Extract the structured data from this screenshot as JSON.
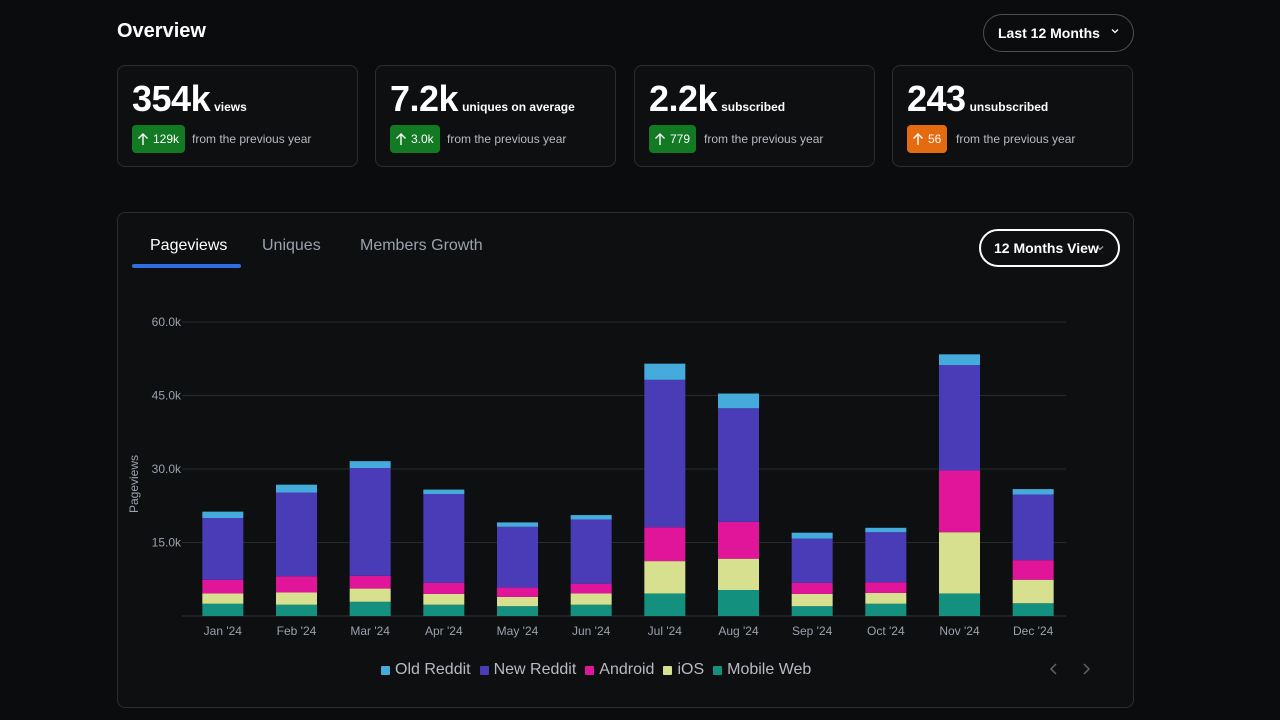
{
  "header": {
    "title": "Overview",
    "range_select": "Last 12 Months"
  },
  "stats": [
    {
      "value": "354k",
      "unit": "views",
      "delta": "129k",
      "delta_text": "from the previous year",
      "delta_color": "#117a22"
    },
    {
      "value": "7.2k",
      "unit": "uniques on average",
      "delta": "3.0k",
      "delta_text": "from the previous year",
      "delta_color": "#117a22"
    },
    {
      "value": "2.2k",
      "unit": "subscribed",
      "delta": "779",
      "delta_text": "from the previous year",
      "delta_color": "#117a22"
    },
    {
      "value": "243",
      "unit": "unsubscribed",
      "delta": "56",
      "delta_text": "from the previous year",
      "delta_color": "#e46b0f"
    }
  ],
  "tabs": [
    {
      "label": "Pageviews",
      "active": true
    },
    {
      "label": "Uniques",
      "active": false
    },
    {
      "label": "Members Growth",
      "active": false
    }
  ],
  "view_select": "12 Months View",
  "chart_data": {
    "type": "bar",
    "stacked": true,
    "title": "",
    "xlabel": "",
    "ylabel": "Pageviews",
    "ylim": [
      0,
      60000
    ],
    "yticks": [
      15000,
      30000,
      45000,
      60000
    ],
    "ytick_labels": [
      "15.0k",
      "30.0k",
      "45.0k",
      "60.0k"
    ],
    "grid": true,
    "legend_position": "bottom",
    "categories": [
      "Jan '24",
      "Feb '24",
      "Mar '24",
      "Apr '24",
      "May '24",
      "Jun '24",
      "Jul '24",
      "Aug '24",
      "Sep '24",
      "Oct '24",
      "Nov '24",
      "Dec '24"
    ],
    "series": [
      {
        "name": "Mobile Web",
        "color": "#14907f",
        "values": [
          2500,
          2300,
          2900,
          2300,
          2000,
          2300,
          4600,
          5300,
          2000,
          2500,
          4600,
          2600
        ]
      },
      {
        "name": "iOS",
        "color": "#d6e08f",
        "values": [
          2100,
          2500,
          2700,
          2200,
          1900,
          2300,
          6600,
          6400,
          2500,
          2200,
          12500,
          4800
        ]
      },
      {
        "name": "Android",
        "color": "#e0159a",
        "values": [
          2800,
          3300,
          2600,
          2300,
          1900,
          2000,
          6900,
          7500,
          2300,
          2200,
          12600,
          4000
        ]
      },
      {
        "name": "New Reddit",
        "color": "#4a3bb7",
        "values": [
          12600,
          17100,
          22000,
          18100,
          12400,
          13100,
          30100,
          23200,
          9000,
          10200,
          21500,
          13400
        ]
      },
      {
        "name": "Old Reddit",
        "color": "#45abdd",
        "values": [
          1300,
          1600,
          1400,
          900,
          900,
          900,
          3300,
          3000,
          1200,
          900,
          2200,
          1100
        ]
      }
    ]
  },
  "legend": [
    {
      "label": "Old Reddit",
      "color": "#45abdd"
    },
    {
      "label": "New Reddit",
      "color": "#4a3bb7"
    },
    {
      "label": "Android",
      "color": "#e0159a"
    },
    {
      "label": "iOS",
      "color": "#d6e08f"
    },
    {
      "label": "Mobile Web",
      "color": "#14907f"
    }
  ],
  "icons": {
    "range_chevron": "chevron-down-icon",
    "delta_arrow": "arrow-up-icon",
    "pager_prev": "chevron-left-icon",
    "pager_next": "chevron-right-icon"
  }
}
